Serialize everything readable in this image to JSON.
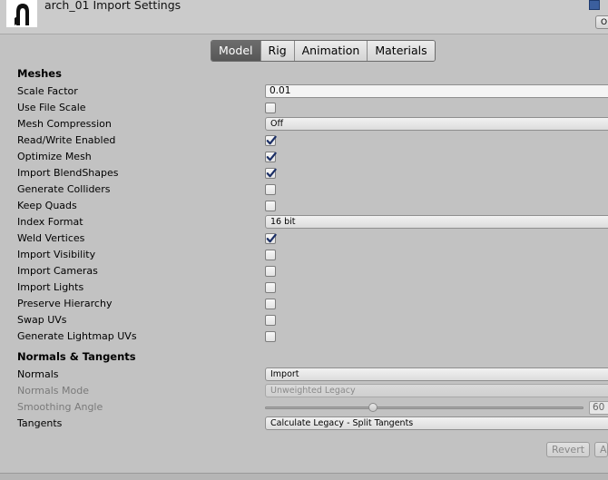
{
  "window": {
    "title": "arch_01 Import Settings",
    "side_button_label": "O"
  },
  "tabs": [
    {
      "label": "Model",
      "active": true
    },
    {
      "label": "Rig",
      "active": false
    },
    {
      "label": "Animation",
      "active": false
    },
    {
      "label": "Materials",
      "active": false
    }
  ],
  "meshes": {
    "heading": "Meshes",
    "scale_factor": {
      "label": "Scale Factor",
      "value": "0.01"
    },
    "use_file_scale": {
      "label": "Use File Scale",
      "checked": false
    },
    "mesh_compression": {
      "label": "Mesh Compression",
      "value": "Off"
    },
    "read_write_enabled": {
      "label": "Read/Write Enabled",
      "checked": true
    },
    "optimize_mesh": {
      "label": "Optimize Mesh",
      "checked": true
    },
    "import_blendshapes": {
      "label": "Import BlendShapes",
      "checked": true
    },
    "generate_colliders": {
      "label": "Generate Colliders",
      "checked": false
    },
    "keep_quads": {
      "label": "Keep Quads",
      "checked": false
    },
    "index_format": {
      "label": "Index Format",
      "value": "16 bit"
    },
    "weld_vertices": {
      "label": "Weld Vertices",
      "checked": true
    },
    "import_visibility": {
      "label": "Import Visibility",
      "checked": false
    },
    "import_cameras": {
      "label": "Import Cameras",
      "checked": false
    },
    "import_lights": {
      "label": "Import Lights",
      "checked": false
    },
    "preserve_hierarchy": {
      "label": "Preserve Hierarchy",
      "checked": false
    },
    "swap_uvs": {
      "label": "Swap UVs",
      "checked": false
    },
    "generate_lightmap_uvs": {
      "label": "Generate Lightmap UVs",
      "checked": false
    }
  },
  "normals_tangents": {
    "heading": "Normals & Tangents",
    "normals": {
      "label": "Normals",
      "value": "Import"
    },
    "normals_mode": {
      "label": "Normals Mode",
      "value": "Unweighted Legacy"
    },
    "smoothing_angle": {
      "label": "Smoothing Angle",
      "value": "60",
      "slider_fraction": 0.333
    },
    "tangents": {
      "label": "Tangents",
      "value": "Calculate Legacy - Split Tangents"
    }
  },
  "footer": {
    "revert_label": "Revert",
    "apply_label": "Apply"
  },
  "colors": {
    "panel": "#c2c2c2",
    "active_tab": "#606060",
    "checkmark": "#1b2f66"
  }
}
